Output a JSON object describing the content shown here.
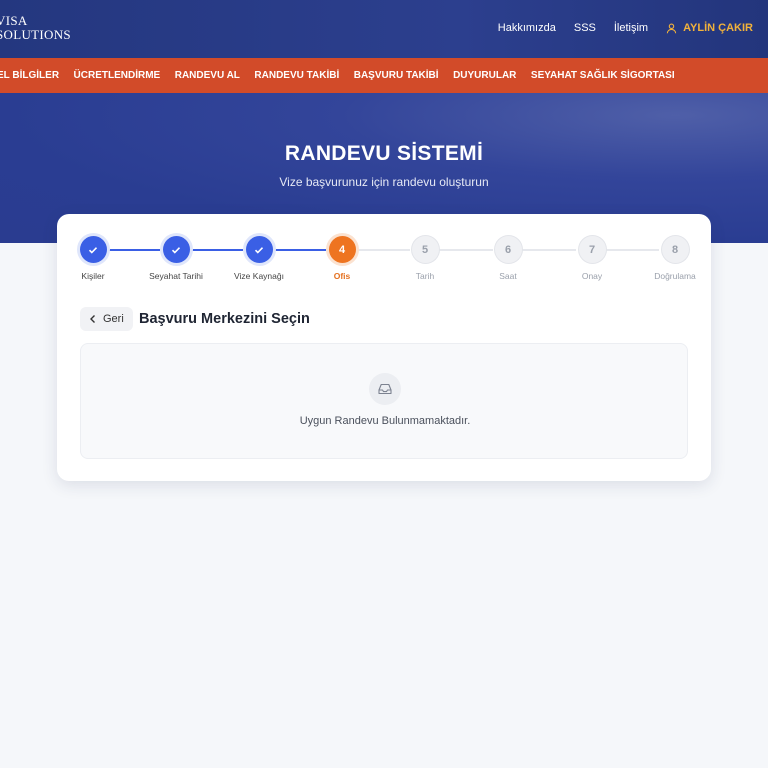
{
  "logo": {
    "line1": "VISA",
    "line2": "SOLUTIONS"
  },
  "topnav": {
    "links": [
      "Hakkımızda",
      "SSS",
      "İletişim"
    ],
    "user": "AYLİN ÇAKIR"
  },
  "mainnav": {
    "items": [
      "EL BİLGİLER",
      "ÜCRETLENDİRME",
      "RANDEVU AL",
      "RANDEVU TAKİBİ",
      "BAŞVURU TAKİBİ",
      "DUYURULAR",
      "SEYAHAT SAĞLIK SİGORTASI"
    ]
  },
  "hero": {
    "title": "RANDEVU SİSTEMİ",
    "subtitle": "Vize başvurunuz için randevu oluşturun"
  },
  "steps": [
    {
      "num": "1",
      "label": "Kişiler",
      "state": "done"
    },
    {
      "num": "2",
      "label": "Seyahat Tarihi",
      "state": "done"
    },
    {
      "num": "3",
      "label": "Vize Kaynağı",
      "state": "done"
    },
    {
      "num": "4",
      "label": "Ofis",
      "state": "active"
    },
    {
      "num": "5",
      "label": "Tarih",
      "state": "pending"
    },
    {
      "num": "6",
      "label": "Saat",
      "state": "pending"
    },
    {
      "num": "7",
      "label": "Onay",
      "state": "pending"
    },
    {
      "num": "8",
      "label": "Doğrulama",
      "state": "pending"
    }
  ],
  "section": {
    "back_label": "Geri",
    "title": "Başvuru Merkezini Seçin"
  },
  "empty_state": {
    "icon": "inbox-icon",
    "message": "Uygun Randevu Bulunmamaktadır."
  },
  "colors": {
    "brand_blue": "#2c3f8e",
    "nav_red": "#d24b29",
    "step_done": "#3a5fe5",
    "step_active": "#ee7420",
    "user_accent": "#f2b23b"
  }
}
